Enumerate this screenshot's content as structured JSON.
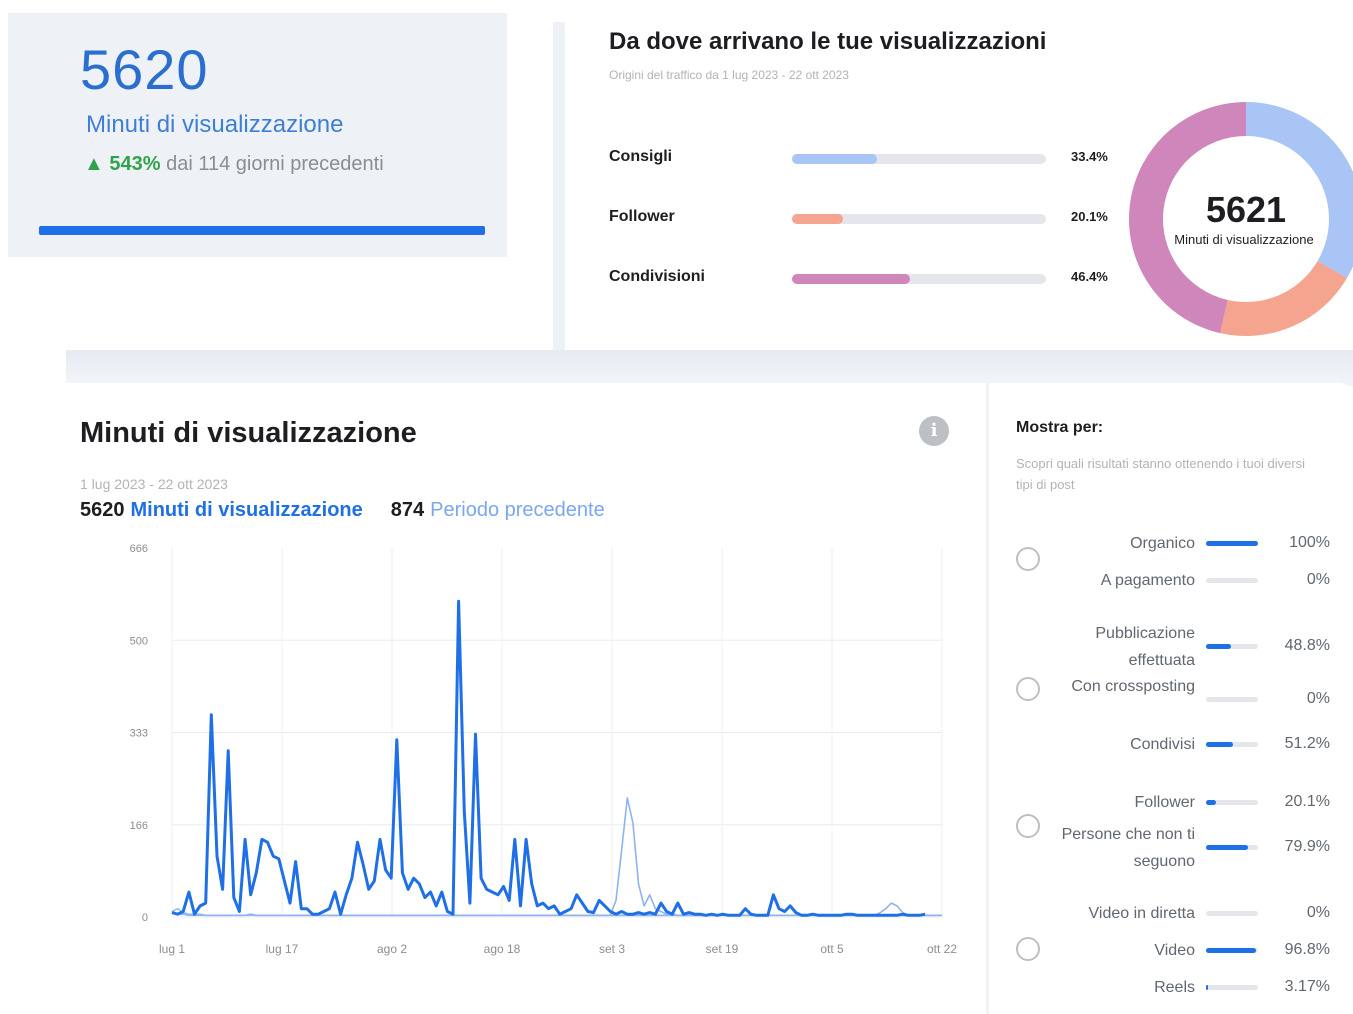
{
  "kpi": {
    "value": "5620",
    "label": "Minuti di visualizzazione",
    "change_pct": "543%",
    "change_text": "dai 114 giorni precedenti"
  },
  "traffic": {
    "title": "Da dove arrivano le tue visualizzazioni",
    "subtitle": "Origini del traffico da 1 lug 2023 - 22 ott 2023",
    "sources": [
      {
        "label": "Consigli",
        "pct_text": "33.4%",
        "value": 33.4,
        "color": "#a8c5f5"
      },
      {
        "label": "Follower",
        "pct_text": "20.1%",
        "value": 20.1,
        "color": "#f5a48f"
      },
      {
        "label": "Condivisioni",
        "pct_text": "46.4%",
        "value": 46.4,
        "color": "#cf86bb"
      }
    ],
    "donut_total": "5621",
    "donut_caption": "Minuti di visualizzazione"
  },
  "watch_chart": {
    "title": "Minuti di visualizzazione",
    "date_range": "1 lug 2023 - 22 ott 2023",
    "current_total": "5620",
    "current_label": "Minuti di visualizzazione",
    "previous_total": "874",
    "previous_label": "Periodo precedente",
    "info_icon": "i"
  },
  "chart_data": {
    "type": "line",
    "ylim": [
      0,
      666
    ],
    "y_ticks": [
      "666",
      "500",
      "333",
      "166",
      "0"
    ],
    "x_ticks": [
      "lug 1",
      "lug 17",
      "ago 2",
      "ago 18",
      "set 3",
      "set 19",
      "ott 5",
      "ott 22"
    ],
    "series": [
      {
        "color": "#1f6fe6",
        "values": [
          8,
          5,
          10,
          45,
          5,
          20,
          25,
          365,
          110,
          50,
          300,
          35,
          10,
          140,
          40,
          80,
          140,
          135,
          110,
          105,
          65,
          25,
          100,
          15,
          15,
          5,
          5,
          10,
          15,
          45,
          5,
          40,
          70,
          135,
          95,
          50,
          65,
          140,
          85,
          70,
          320,
          80,
          50,
          70,
          60,
          35,
          45,
          20,
          45,
          10,
          5,
          570,
          190,
          25,
          330,
          70,
          50,
          45,
          40,
          55,
          30,
          140,
          20,
          140,
          60,
          20,
          25,
          15,
          20,
          5,
          10,
          15,
          40,
          25,
          10,
          8,
          30,
          20,
          10,
          5,
          10,
          5,
          5,
          8,
          5,
          8,
          5,
          25,
          10,
          5,
          25,
          5,
          8,
          5,
          5,
          3,
          5,
          3,
          5,
          3,
          3,
          3,
          15,
          5,
          3,
          3,
          3,
          40,
          15,
          10,
          20,
          8,
          3,
          3,
          5,
          3,
          3,
          3,
          3,
          3,
          5,
          5,
          3,
          3,
          3,
          3,
          3,
          3,
          3,
          3,
          5,
          3,
          3,
          3,
          5
        ],
        "x_start": 0
      },
      {
        "color": "#8fb3f0",
        "values": [
          8,
          5,
          5,
          3,
          3,
          3,
          3,
          3,
          3,
          3,
          3,
          3,
          3,
          3,
          5,
          3,
          3,
          3,
          3,
          3,
          3,
          3,
          3,
          3,
          3,
          3,
          3,
          3,
          3,
          3,
          3,
          3,
          3,
          3,
          3,
          3,
          3,
          3,
          3,
          3,
          3,
          3,
          3,
          3,
          3,
          3,
          3,
          3,
          3,
          3,
          3,
          3,
          3,
          3,
          3,
          3,
          3,
          3,
          3,
          3,
          3,
          3,
          3,
          3,
          3,
          3,
          3,
          3,
          3,
          3,
          3,
          3,
          3,
          3,
          3,
          3,
          3,
          3,
          3,
          3,
          3,
          3,
          3,
          3,
          3,
          3,
          3,
          3,
          3,
          3,
          3,
          3,
          3,
          3,
          3,
          3,
          3,
          3,
          3,
          3,
          3,
          3,
          3,
          3,
          3,
          3,
          3,
          3,
          3,
          3,
          3,
          3,
          3,
          3,
          3,
          3,
          3,
          3,
          3,
          3,
          3,
          3,
          3,
          3,
          3,
          3,
          3,
          3,
          3,
          3,
          3,
          3,
          3,
          3,
          3,
          3,
          3,
          3
        ],
        "x_start": 0
      },
      {
        "color": "#9dbdf3",
        "values": [
          10,
          15,
          8,
          5,
          5,
          5,
          3,
          3,
          3,
          3,
          3,
          3,
          3,
          3,
          3,
          3,
          3,
          3,
          3,
          3,
          3,
          3,
          3,
          3,
          3,
          3,
          3,
          3,
          3,
          3,
          3,
          3,
          3,
          3,
          3,
          3,
          3,
          3,
          3,
          3,
          3,
          3,
          3,
          3,
          3,
          3,
          3,
          3,
          3,
          3,
          3,
          3,
          3,
          3,
          3,
          3,
          3,
          3,
          3,
          3,
          3,
          3,
          3,
          3,
          3,
          3,
          3,
          3,
          3,
          3,
          3,
          3,
          3,
          3,
          3,
          3,
          3,
          3,
          3,
          3,
          3,
          3,
          3,
          3,
          3,
          3,
          3,
          3,
          3,
          3,
          3,
          3,
          3,
          3,
          3,
          3,
          3,
          3,
          3,
          3,
          3,
          3,
          3,
          3,
          3,
          3,
          3,
          3,
          3,
          3,
          3,
          3,
          3,
          3,
          3,
          3,
          3,
          3,
          3,
          3,
          3,
          3,
          3,
          3,
          3,
          3,
          3,
          3,
          3,
          3,
          3,
          3,
          3,
          3,
          3,
          3,
          3,
          3
        ],
        "x_start": 0
      },
      {
        "color": "#8fb3f0",
        "values": [
          3,
          30,
          120,
          215,
          170,
          60,
          20,
          40,
          15,
          10,
          5,
          5,
          3,
          3,
          3,
          3,
          3,
          3,
          3,
          3
        ],
        "x_start": 78
      },
      {
        "color": "#8fb3f0",
        "values": [
          3,
          8,
          15,
          25,
          20,
          8,
          3
        ],
        "x_start": 125
      }
    ]
  },
  "show_by": {
    "title": "Mostra per:",
    "subtitle": "Scopri quali risultati stanno ottenendo i tuoi diversi tipi di post",
    "groups": [
      {
        "rows": [
          {
            "label": "Organico",
            "pct_text": "100%",
            "value": 100
          },
          {
            "label": "A pagamento",
            "pct_text": "0%",
            "value": 0
          }
        ]
      },
      {
        "rows": [
          {
            "label": "Pubblicazione effettuata",
            "pct_text": "48.8%",
            "value": 48.8
          },
          {
            "label": "Con crossposting",
            "pct_text": "0%",
            "value": 0
          },
          {
            "label": "Condivisi",
            "pct_text": "51.2%",
            "value": 51.2
          }
        ]
      },
      {
        "rows": [
          {
            "label": "Follower",
            "pct_text": "20.1%",
            "value": 20.1
          },
          {
            "label": "Persone che non ti seguono",
            "pct_text": "79.9%",
            "value": 79.9
          }
        ]
      },
      {
        "rows": [
          {
            "label": "Video in diretta",
            "pct_text": "0%",
            "value": 0
          },
          {
            "label": "Video",
            "pct_text": "96.8%",
            "value": 96.8
          },
          {
            "label": "Reels",
            "pct_text": "3.17%",
            "value": 3.17
          }
        ]
      }
    ]
  }
}
